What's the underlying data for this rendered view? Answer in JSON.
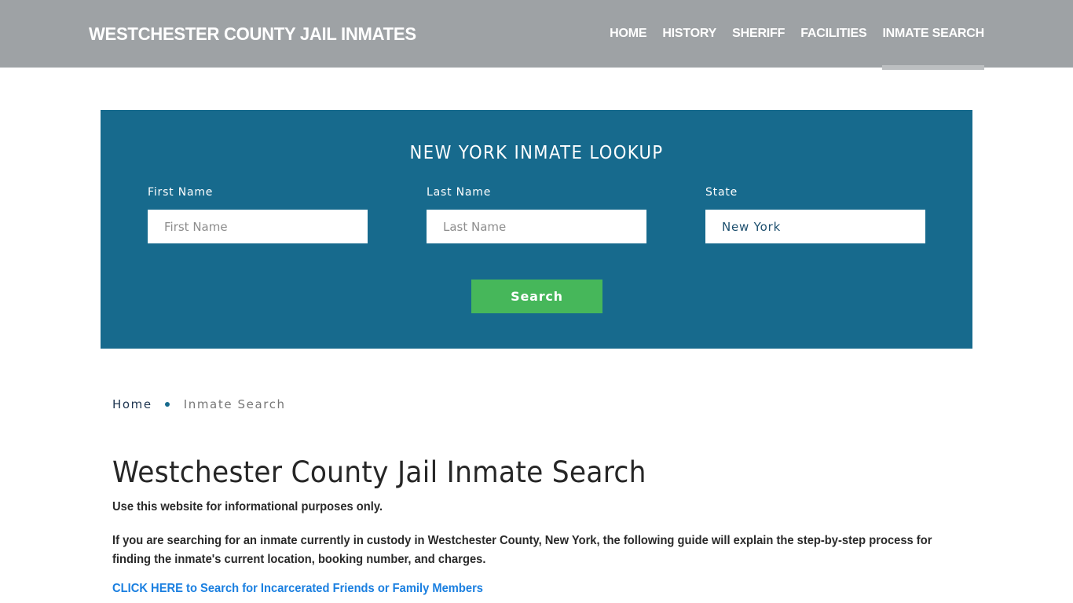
{
  "header": {
    "brand": "WESTCHESTER COUNTY JAIL INMATES",
    "nav": [
      {
        "label": "HOME",
        "active": false
      },
      {
        "label": "HISTORY",
        "active": false
      },
      {
        "label": "SHERIFF",
        "active": false
      },
      {
        "label": "FACILITIES",
        "active": false
      },
      {
        "label": "INMATE SEARCH",
        "active": true
      }
    ]
  },
  "lookup": {
    "title": "NEW YORK INMATE LOOKUP",
    "first_name": {
      "label": "First Name",
      "placeholder": "First Name",
      "value": ""
    },
    "last_name": {
      "label": "Last Name",
      "placeholder": "Last Name",
      "value": ""
    },
    "state": {
      "label": "State",
      "value": "New York"
    },
    "search_label": "Search"
  },
  "breadcrumb": {
    "home": "Home",
    "current": "Inmate Search"
  },
  "content": {
    "title": "Westchester County Jail Inmate Search",
    "disclaimer": "Use this website for informational purposes only.",
    "intro": "If you are searching for an inmate currently in custody in Westchester County, New York, the following guide will explain the step-by-step process for finding the inmate's current location, booking number, and charges.",
    "cta_link": "CLICK HERE to Search for Incarcerated Friends or Family Members"
  },
  "colors": {
    "header_bg": "#9ea2a5",
    "lookup_bg": "#176a8d",
    "search_button": "#46b75a",
    "link": "#1a7fe0"
  }
}
